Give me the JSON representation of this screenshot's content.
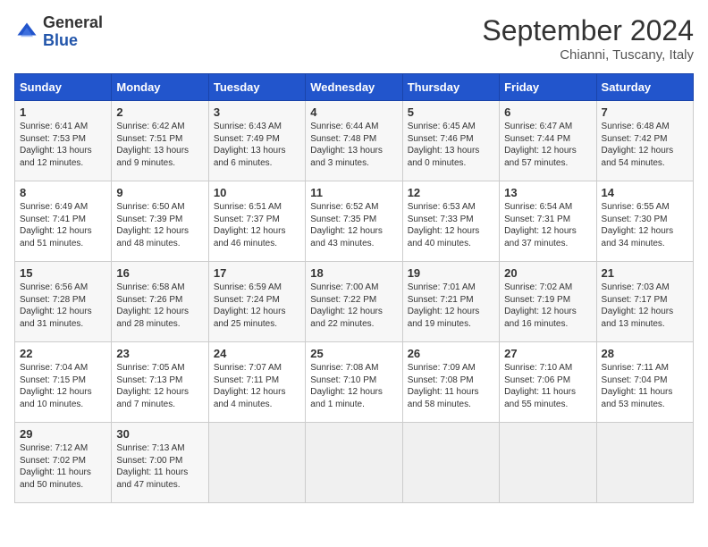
{
  "header": {
    "logo_general": "General",
    "logo_blue": "Blue",
    "month": "September 2024",
    "location": "Chianni, Tuscany, Italy"
  },
  "days_of_week": [
    "Sunday",
    "Monday",
    "Tuesday",
    "Wednesday",
    "Thursday",
    "Friday",
    "Saturday"
  ],
  "weeks": [
    [
      {
        "day": 1,
        "sunrise": "6:41 AM",
        "sunset": "7:53 PM",
        "daylight": "13 hours and 12 minutes."
      },
      {
        "day": 2,
        "sunrise": "6:42 AM",
        "sunset": "7:51 PM",
        "daylight": "13 hours and 9 minutes."
      },
      {
        "day": 3,
        "sunrise": "6:43 AM",
        "sunset": "7:49 PM",
        "daylight": "13 hours and 6 minutes."
      },
      {
        "day": 4,
        "sunrise": "6:44 AM",
        "sunset": "7:48 PM",
        "daylight": "13 hours and 3 minutes."
      },
      {
        "day": 5,
        "sunrise": "6:45 AM",
        "sunset": "7:46 PM",
        "daylight": "13 hours and 0 minutes."
      },
      {
        "day": 6,
        "sunrise": "6:47 AM",
        "sunset": "7:44 PM",
        "daylight": "12 hours and 57 minutes."
      },
      {
        "day": 7,
        "sunrise": "6:48 AM",
        "sunset": "7:42 PM",
        "daylight": "12 hours and 54 minutes."
      }
    ],
    [
      {
        "day": 8,
        "sunrise": "6:49 AM",
        "sunset": "7:41 PM",
        "daylight": "12 hours and 51 minutes."
      },
      {
        "day": 9,
        "sunrise": "6:50 AM",
        "sunset": "7:39 PM",
        "daylight": "12 hours and 48 minutes."
      },
      {
        "day": 10,
        "sunrise": "6:51 AM",
        "sunset": "7:37 PM",
        "daylight": "12 hours and 46 minutes."
      },
      {
        "day": 11,
        "sunrise": "6:52 AM",
        "sunset": "7:35 PM",
        "daylight": "12 hours and 43 minutes."
      },
      {
        "day": 12,
        "sunrise": "6:53 AM",
        "sunset": "7:33 PM",
        "daylight": "12 hours and 40 minutes."
      },
      {
        "day": 13,
        "sunrise": "6:54 AM",
        "sunset": "7:31 PM",
        "daylight": "12 hours and 37 minutes."
      },
      {
        "day": 14,
        "sunrise": "6:55 AM",
        "sunset": "7:30 PM",
        "daylight": "12 hours and 34 minutes."
      }
    ],
    [
      {
        "day": 15,
        "sunrise": "6:56 AM",
        "sunset": "7:28 PM",
        "daylight": "12 hours and 31 minutes."
      },
      {
        "day": 16,
        "sunrise": "6:58 AM",
        "sunset": "7:26 PM",
        "daylight": "12 hours and 28 minutes."
      },
      {
        "day": 17,
        "sunrise": "6:59 AM",
        "sunset": "7:24 PM",
        "daylight": "12 hours and 25 minutes."
      },
      {
        "day": 18,
        "sunrise": "7:00 AM",
        "sunset": "7:22 PM",
        "daylight": "12 hours and 22 minutes."
      },
      {
        "day": 19,
        "sunrise": "7:01 AM",
        "sunset": "7:21 PM",
        "daylight": "12 hours and 19 minutes."
      },
      {
        "day": 20,
        "sunrise": "7:02 AM",
        "sunset": "7:19 PM",
        "daylight": "12 hours and 16 minutes."
      },
      {
        "day": 21,
        "sunrise": "7:03 AM",
        "sunset": "7:17 PM",
        "daylight": "12 hours and 13 minutes."
      }
    ],
    [
      {
        "day": 22,
        "sunrise": "7:04 AM",
        "sunset": "7:15 PM",
        "daylight": "12 hours and 10 minutes."
      },
      {
        "day": 23,
        "sunrise": "7:05 AM",
        "sunset": "7:13 PM",
        "daylight": "12 hours and 7 minutes."
      },
      {
        "day": 24,
        "sunrise": "7:07 AM",
        "sunset": "7:11 PM",
        "daylight": "12 hours and 4 minutes."
      },
      {
        "day": 25,
        "sunrise": "7:08 AM",
        "sunset": "7:10 PM",
        "daylight": "12 hours and 1 minute."
      },
      {
        "day": 26,
        "sunrise": "7:09 AM",
        "sunset": "7:08 PM",
        "daylight": "11 hours and 58 minutes."
      },
      {
        "day": 27,
        "sunrise": "7:10 AM",
        "sunset": "7:06 PM",
        "daylight": "11 hours and 55 minutes."
      },
      {
        "day": 28,
        "sunrise": "7:11 AM",
        "sunset": "7:04 PM",
        "daylight": "11 hours and 53 minutes."
      }
    ],
    [
      {
        "day": 29,
        "sunrise": "7:12 AM",
        "sunset": "7:02 PM",
        "daylight": "11 hours and 50 minutes."
      },
      {
        "day": 30,
        "sunrise": "7:13 AM",
        "sunset": "7:00 PM",
        "daylight": "11 hours and 47 minutes."
      },
      null,
      null,
      null,
      null,
      null
    ]
  ]
}
